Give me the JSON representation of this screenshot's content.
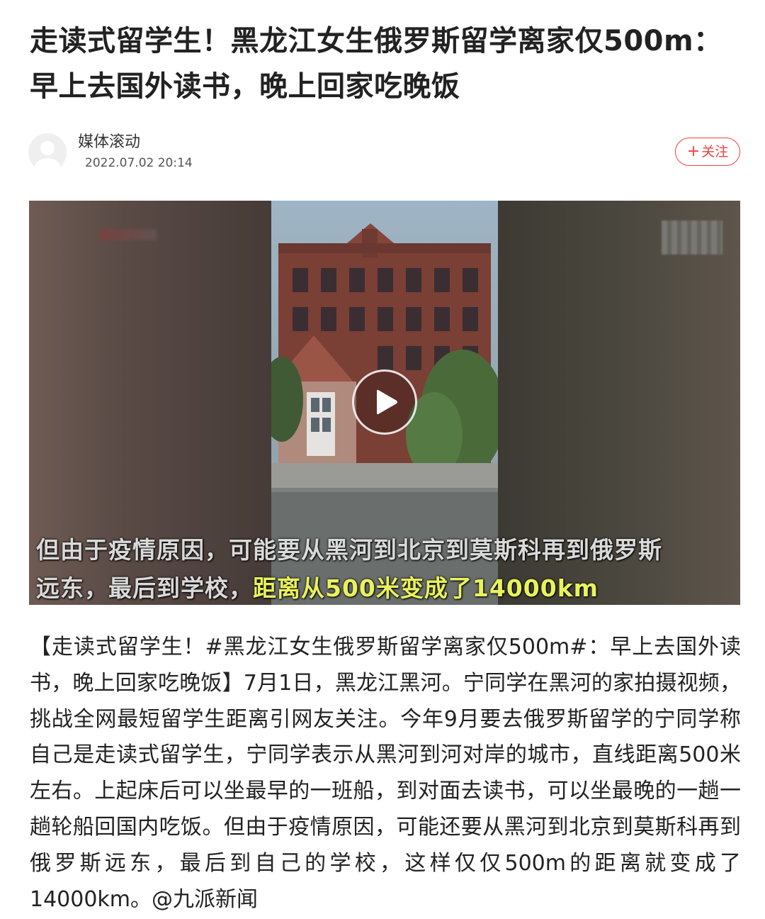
{
  "article": {
    "title_line1": "走读式留学生！黑龙江女生俄罗斯留学离家仅500m：",
    "title_line2": "早上去国外读书，晚上回家吃晚饭"
  },
  "author": {
    "name": "媒体滚动",
    "time": "2022.07.02 20:14",
    "follow_label": "关注",
    "follow_icon": "plus-icon"
  },
  "video": {
    "subtitle_line1": "但由于疫情原因，可能要从黑河到北京到莫斯科再到俄罗斯",
    "subtitle_line2_normal": "远东，最后到学校，",
    "subtitle_line2_highlight": "距离从500米变成了14000km",
    "play_icon": "play-icon",
    "highlight_color": "#e9f25a"
  },
  "body": {
    "text": "【走读式留学生！#黑龙江女生俄罗斯留学离家仅500m#：早上去国外读书，晚上回家吃晚饭】7月1日，黑龙江黑河。宁同学在黑河的家拍摄视频，挑战全网最短留学生距离引网友关注。今年9月要去俄罗斯留学的宁同学称自己是走读式留学生，宁同学表示从黑河到河对岸的城市，直线距离500米左右。上起床后可以坐最早的一班船，到对面去读书，可以坐最晚的一趟一趟轮船回国内吃饭。但由于疫情原因，可能还要从黑河到北京到莫斯科再到俄罗斯远东，最后到自己的学校，这样仅仅500m的距离就变成了14000km。@九派新闻"
  },
  "colors": {
    "accent": "#f04142",
    "title": "#222222",
    "meta": "#555555"
  }
}
